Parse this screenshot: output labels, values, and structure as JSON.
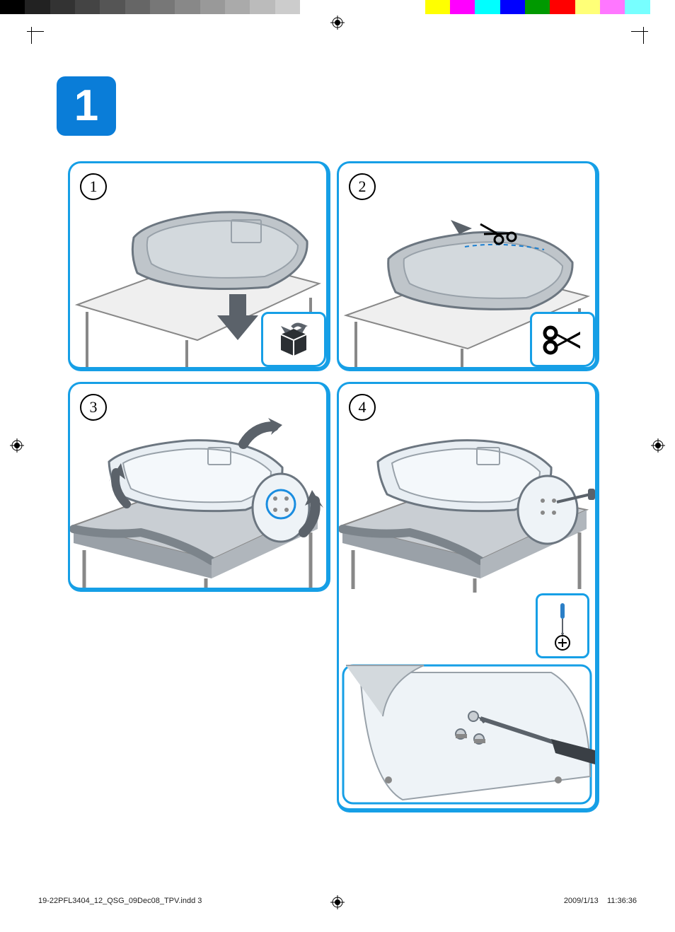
{
  "section_number": "1",
  "steps": {
    "s1": "1",
    "s2": "2",
    "s3": "3",
    "s4": "4"
  },
  "footer": {
    "filename": "19-22PFL3404_12_QSG_09Dec08_TPV.indd   3",
    "date": "2009/1/13",
    "time": "11:36:36"
  },
  "icons": {
    "unbox": "unbox-icon",
    "scissors": "scissors-icon",
    "screwdriver": "screwdriver-icon"
  }
}
